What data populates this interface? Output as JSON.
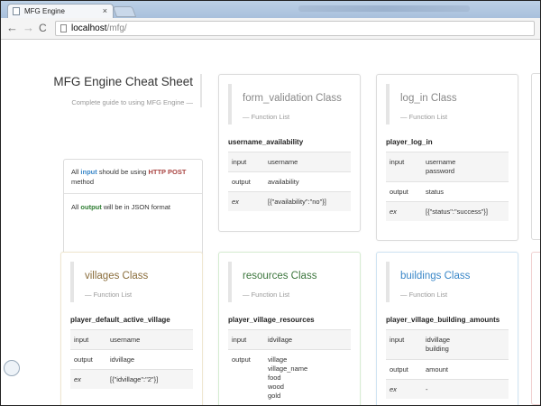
{
  "browser": {
    "tab_title": "MFG Engine",
    "tab_close": "×",
    "url_host": "localhost",
    "url_path": "/mfg/",
    "back_glyph": "←",
    "forward_glyph": "→",
    "reload_glyph": "C"
  },
  "intro": {
    "title": "MFG Engine Cheat Sheet",
    "subtitle": "Complete guide to using MFG Engine —",
    "note1_pre": "All ",
    "note1_kw": "input",
    "note1_mid": " should be using ",
    "note1_kw2": "HTTP POST",
    "note1_post": " method",
    "note2_pre": "All ",
    "note2_kw": "output",
    "note2_post": " will be in JSON format"
  },
  "cards": [
    {
      "title": "form_validation Class",
      "subtitle": "— Function List",
      "function": "username_availability",
      "rows": [
        {
          "key": "input",
          "values": [
            "username"
          ]
        },
        {
          "key": "output",
          "values": [
            "availability"
          ]
        },
        {
          "key": "ex",
          "values": [
            "[{\"availability\":\"no\"}]"
          ]
        }
      ]
    },
    {
      "title": "log_in Class",
      "subtitle": "— Function List",
      "function": "player_log_in",
      "rows": [
        {
          "key": "input",
          "values": [
            "username",
            "password"
          ]
        },
        {
          "key": "output",
          "values": [
            "status"
          ]
        },
        {
          "key": "ex",
          "values": [
            "[{\"status\":\"success\"}]"
          ]
        }
      ]
    },
    {
      "title": "villages Class",
      "subtitle": "— Function List",
      "function": "player_default_active_village",
      "rows": [
        {
          "key": "input",
          "values": [
            "username"
          ]
        },
        {
          "key": "output",
          "values": [
            "idvillage"
          ]
        },
        {
          "key": "ex",
          "values": [
            "[{\"idvillage\":\"2\"}]"
          ]
        }
      ]
    },
    {
      "title": "resources Class",
      "subtitle": "— Function List",
      "function": "player_village_resources",
      "rows": [
        {
          "key": "input",
          "values": [
            "idvillage"
          ]
        },
        {
          "key": "output",
          "values": [
            "village",
            "village_name",
            "food",
            "wood",
            "gold"
          ]
        }
      ]
    },
    {
      "title": "buildings Class",
      "subtitle": "— Function List",
      "function": "player_village_building_amounts",
      "rows": [
        {
          "key": "input",
          "values": [
            "idvillage",
            "building"
          ]
        },
        {
          "key": "output",
          "values": [
            "amount"
          ]
        },
        {
          "key": "ex",
          "values": [
            "-"
          ]
        }
      ]
    }
  ],
  "colors": {
    "villages": "#8a6d3b",
    "resources": "#3c763d",
    "buildings": "#3a87c8",
    "input_keyword": "#a94442",
    "output_keyword": "#2e7d32"
  }
}
